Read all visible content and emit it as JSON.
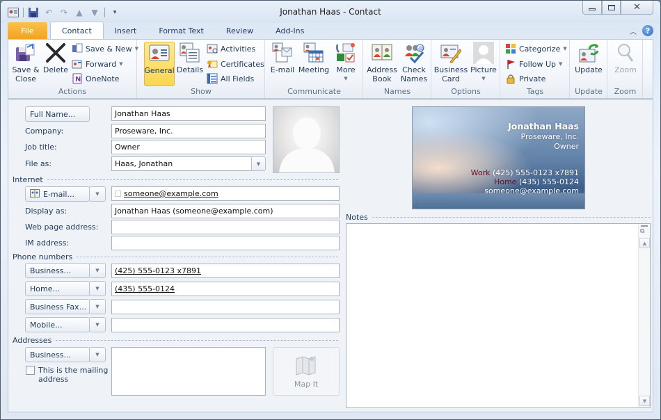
{
  "window": {
    "title": "Jonathan Haas  -  Contact",
    "controls": {
      "minimize": "—",
      "maximize": "□",
      "close": "✕"
    }
  },
  "quick_access": {
    "items": [
      {
        "name": "contact-icon",
        "glyph": "▣"
      },
      {
        "name": "save-icon",
        "glyph": "💾"
      },
      {
        "name": "undo-icon",
        "glyph": "↶"
      },
      {
        "name": "redo-icon",
        "glyph": "↷"
      },
      {
        "name": "up-icon",
        "glyph": "⇡"
      },
      {
        "name": "down-icon",
        "glyph": "⇣"
      },
      {
        "name": "customize-icon",
        "glyph": "▾"
      }
    ]
  },
  "tabs": [
    "File",
    "Contact",
    "Insert",
    "Format Text",
    "Review",
    "Add-Ins"
  ],
  "active_tab": "Contact",
  "ribbon": {
    "groups": {
      "actions": {
        "label": "Actions",
        "save_close": "Save &\nClose",
        "save_close_line1": "Save &",
        "save_close_line2": "Close",
        "delete": "Delete",
        "save_new": "Save & New",
        "forward": "Forward",
        "onenote": "OneNote"
      },
      "show": {
        "label": "Show",
        "general": "General",
        "details": "Details",
        "activities": "Activities",
        "certificates": "Certificates",
        "all_fields": "All Fields"
      },
      "communicate": {
        "label": "Communicate",
        "email": "E-mail",
        "meeting": "Meeting",
        "more": "More"
      },
      "names": {
        "label": "Names",
        "address_book_1": "Address",
        "address_book_2": "Book",
        "check_names_1": "Check",
        "check_names_2": "Names"
      },
      "options": {
        "label": "Options",
        "business_card_1": "Business",
        "business_card_2": "Card",
        "picture": "Picture"
      },
      "tags": {
        "label": "Tags",
        "categorize": "Categorize",
        "follow_up": "Follow Up",
        "private": "Private"
      },
      "update": {
        "label": "Update",
        "update": "Update"
      },
      "zoom": {
        "label": "Zoom",
        "zoom": "Zoom"
      }
    }
  },
  "form": {
    "full_name_button": "Full Name...",
    "full_name": "Jonathan Haas",
    "company_label": "Company:",
    "company": "Proseware, Inc.",
    "job_title_label": "Job title:",
    "job_title": "Owner",
    "file_as_label": "File as:",
    "file_as": "Haas, Jonathan",
    "internet_section": "Internet",
    "email_button": "E-mail...",
    "email": "someone@example.com",
    "display_as_label": "Display as:",
    "display_as": "Jonathan Haas (someone@example.com)",
    "web_page_label": "Web page address:",
    "web_page": "",
    "im_label": "IM address:",
    "im": "",
    "phone_section": "Phone numbers",
    "phones": [
      {
        "button": "Business...",
        "value": "(425) 555-0123 x7891"
      },
      {
        "button": "Home...",
        "value": "(435) 555-0124"
      },
      {
        "button": "Business Fax...",
        "value": ""
      },
      {
        "button": "Mobile...",
        "value": ""
      }
    ],
    "addresses_section": "Addresses",
    "address_button": "Business...",
    "mailing_checkbox_1": "This is the mailing",
    "mailing_checkbox_2": "address",
    "mailing_checked": false,
    "address": "",
    "map_it": "Map It"
  },
  "business_card": {
    "name": "Jonathan Haas",
    "company": "Proseware, Inc.",
    "title": "Owner",
    "work_label": "Work",
    "work_phone": "(425) 555-0123 x7891",
    "home_label": "Home",
    "home_phone": "(435) 555-0124",
    "email": "someone@example.com"
  },
  "notes": {
    "label": "Notes",
    "value": ""
  },
  "colors": {
    "file_tab": "#f2a323",
    "selected_button": "#fbd650",
    "label_text": "#1e395b",
    "card_key": "#6b1020"
  }
}
